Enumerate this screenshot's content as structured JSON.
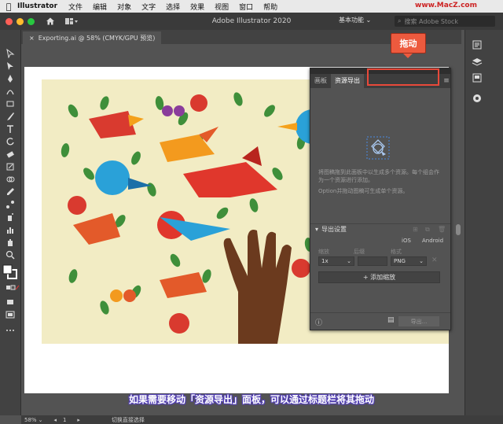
{
  "menubar": {
    "app": "Illustrator",
    "items": [
      "文件",
      "编辑",
      "对象",
      "文字",
      "选择",
      "效果",
      "视图",
      "窗口",
      "帮助"
    ],
    "watermark": "www.MacZ.com"
  },
  "titlebar": {
    "title": "Adobe Illustrator 2020",
    "workspace": "基本功能",
    "search_placeholder": "搜索 Adobe Stock"
  },
  "document": {
    "tab_label": "Exporting.ai @ 58% (CMYK/GPU 预览)",
    "tab_close": "×"
  },
  "panel": {
    "tabs": [
      {
        "label": "画板",
        "active": false
      },
      {
        "label": "资源导出",
        "active": true
      }
    ],
    "hint_line1": "将图稿拖到此面板中以生成多个资源。每个组会作为一个资源进行添加。",
    "hint_line2": "Option并拖动图稿可生成单个资源。",
    "export_settings": "导出设置",
    "platform_ios": "iOS",
    "platform_android": "Android",
    "col_scale": "缩放",
    "col_suffix": "后缀",
    "col_format": "格式",
    "scale_value": "1x",
    "format_value": "PNG",
    "add_scale": "+ 添加缩放",
    "export_button": "导出..."
  },
  "callout": {
    "label": "拖动",
    "color": "#ed5a3e"
  },
  "statusbar": {
    "zoom": "58%",
    "page": "1",
    "tool_hint": "切换直接选择"
  },
  "subtitle": {
    "text": "如果需要移动「资源导出」面板，可以通过标题栏将其拖动"
  }
}
